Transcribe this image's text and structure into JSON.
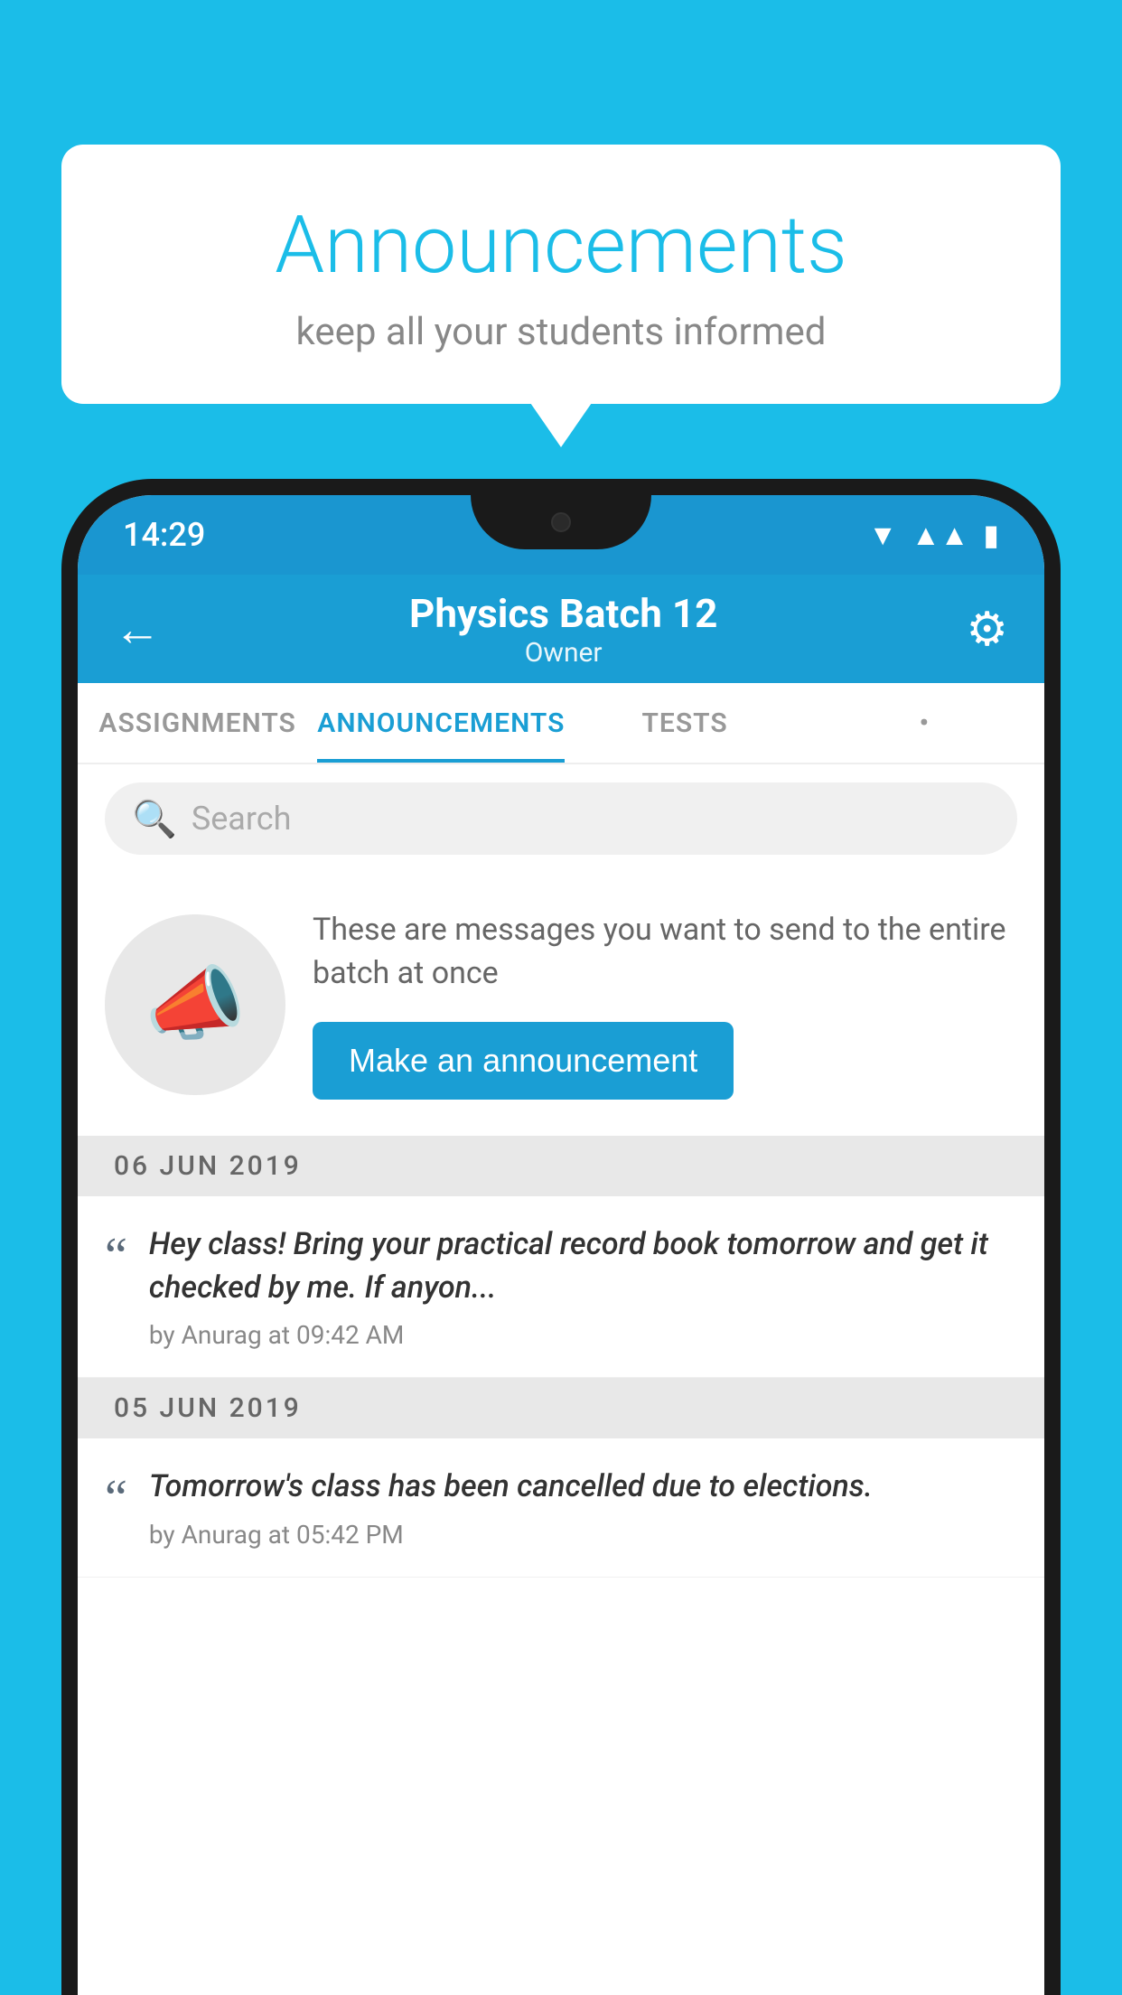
{
  "background_color": "#1BBDE8",
  "speech_bubble": {
    "title": "Announcements",
    "subtitle": "keep all your students informed"
  },
  "phone": {
    "status_bar": {
      "time": "14:29",
      "wifi": "▼",
      "signal": "▲",
      "battery": "▮"
    },
    "header": {
      "back_label": "←",
      "title": "Physics Batch 12",
      "subtitle": "Owner",
      "gear_label": "⚙"
    },
    "tabs": [
      {
        "label": "ASSIGNMENTS",
        "active": false
      },
      {
        "label": "ANNOUNCEMENTS",
        "active": true
      },
      {
        "label": "TESTS",
        "active": false
      },
      {
        "label": "•",
        "active": false
      }
    ],
    "search": {
      "placeholder": "Search"
    },
    "promo": {
      "description": "These are messages you want to send to the entire batch at once",
      "button_label": "Make an announcement"
    },
    "announcements": [
      {
        "date": "06  JUN  2019",
        "text": "Hey class! Bring your practical record book tomorrow and get it checked by me. If anyon...",
        "meta": "by Anurag at 09:42 AM"
      },
      {
        "date": "05  JUN  2019",
        "text": "Tomorrow's class has been cancelled due to elections.",
        "meta": "by Anurag at 05:42 PM"
      }
    ]
  }
}
